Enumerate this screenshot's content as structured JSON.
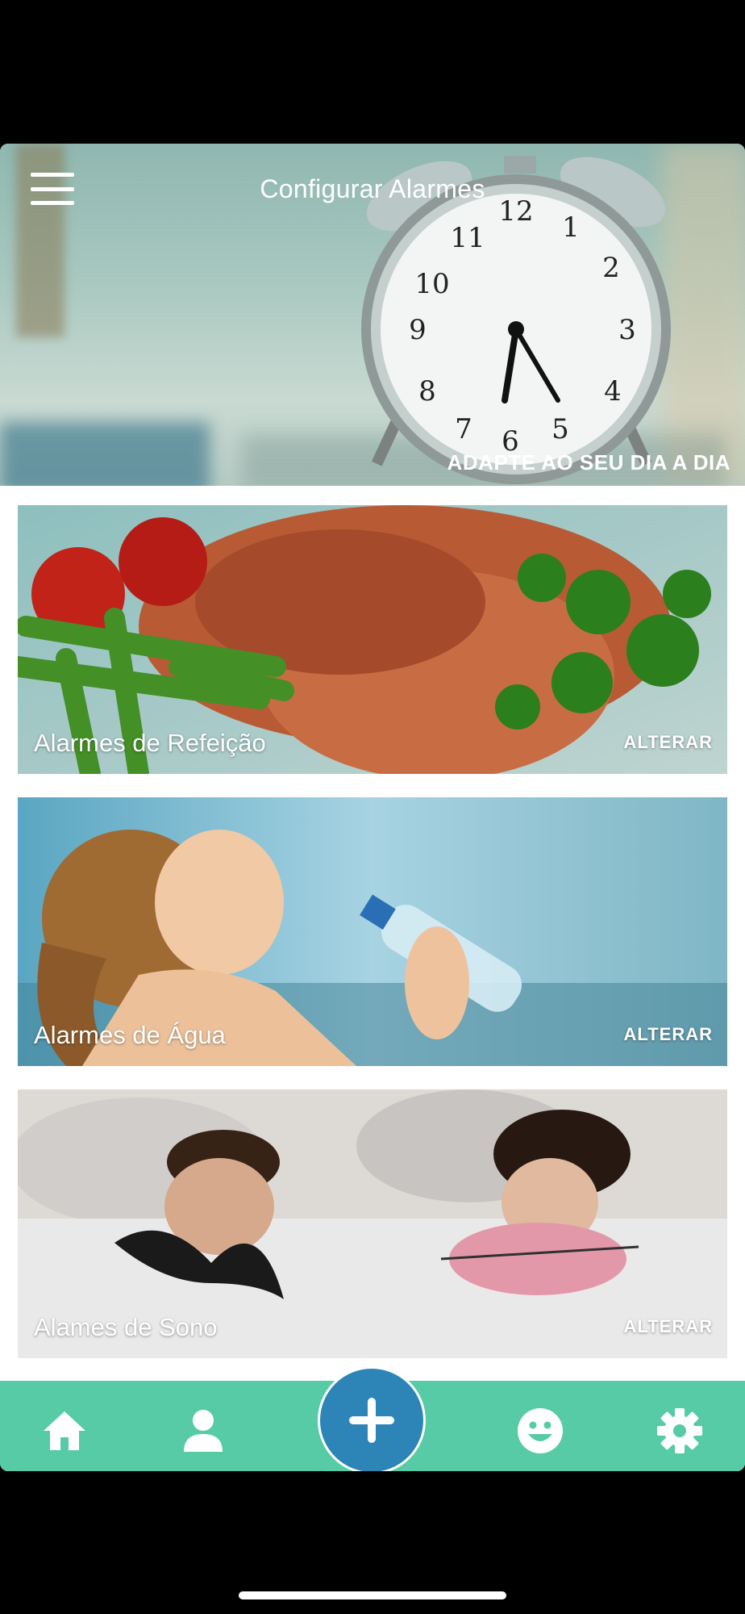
{
  "header": {
    "title": "Configurar Alarmes",
    "caption": "ADAPTE AO SEU DIA A DIA"
  },
  "cards": [
    {
      "label": "Alarmes de Refeição",
      "action": "ALTERAR"
    },
    {
      "label": "Alarmes de Água",
      "action": "ALTERAR"
    },
    {
      "label": "Alames de Sono",
      "action": "ALTERAR"
    }
  ],
  "nav": {
    "items": [
      {
        "icon": "home-icon"
      },
      {
        "icon": "user-icon"
      },
      {
        "icon": "plus-icon"
      },
      {
        "icon": "smiley-icon"
      },
      {
        "icon": "gear-icon"
      }
    ],
    "colors": {
      "bar": "#57cba6",
      "fab": "#2d84b6"
    }
  },
  "clock": {
    "numbers": [
      "12",
      "1",
      "2",
      "3",
      "4",
      "5",
      "6",
      "7",
      "8",
      "9",
      "10",
      "11"
    ]
  }
}
